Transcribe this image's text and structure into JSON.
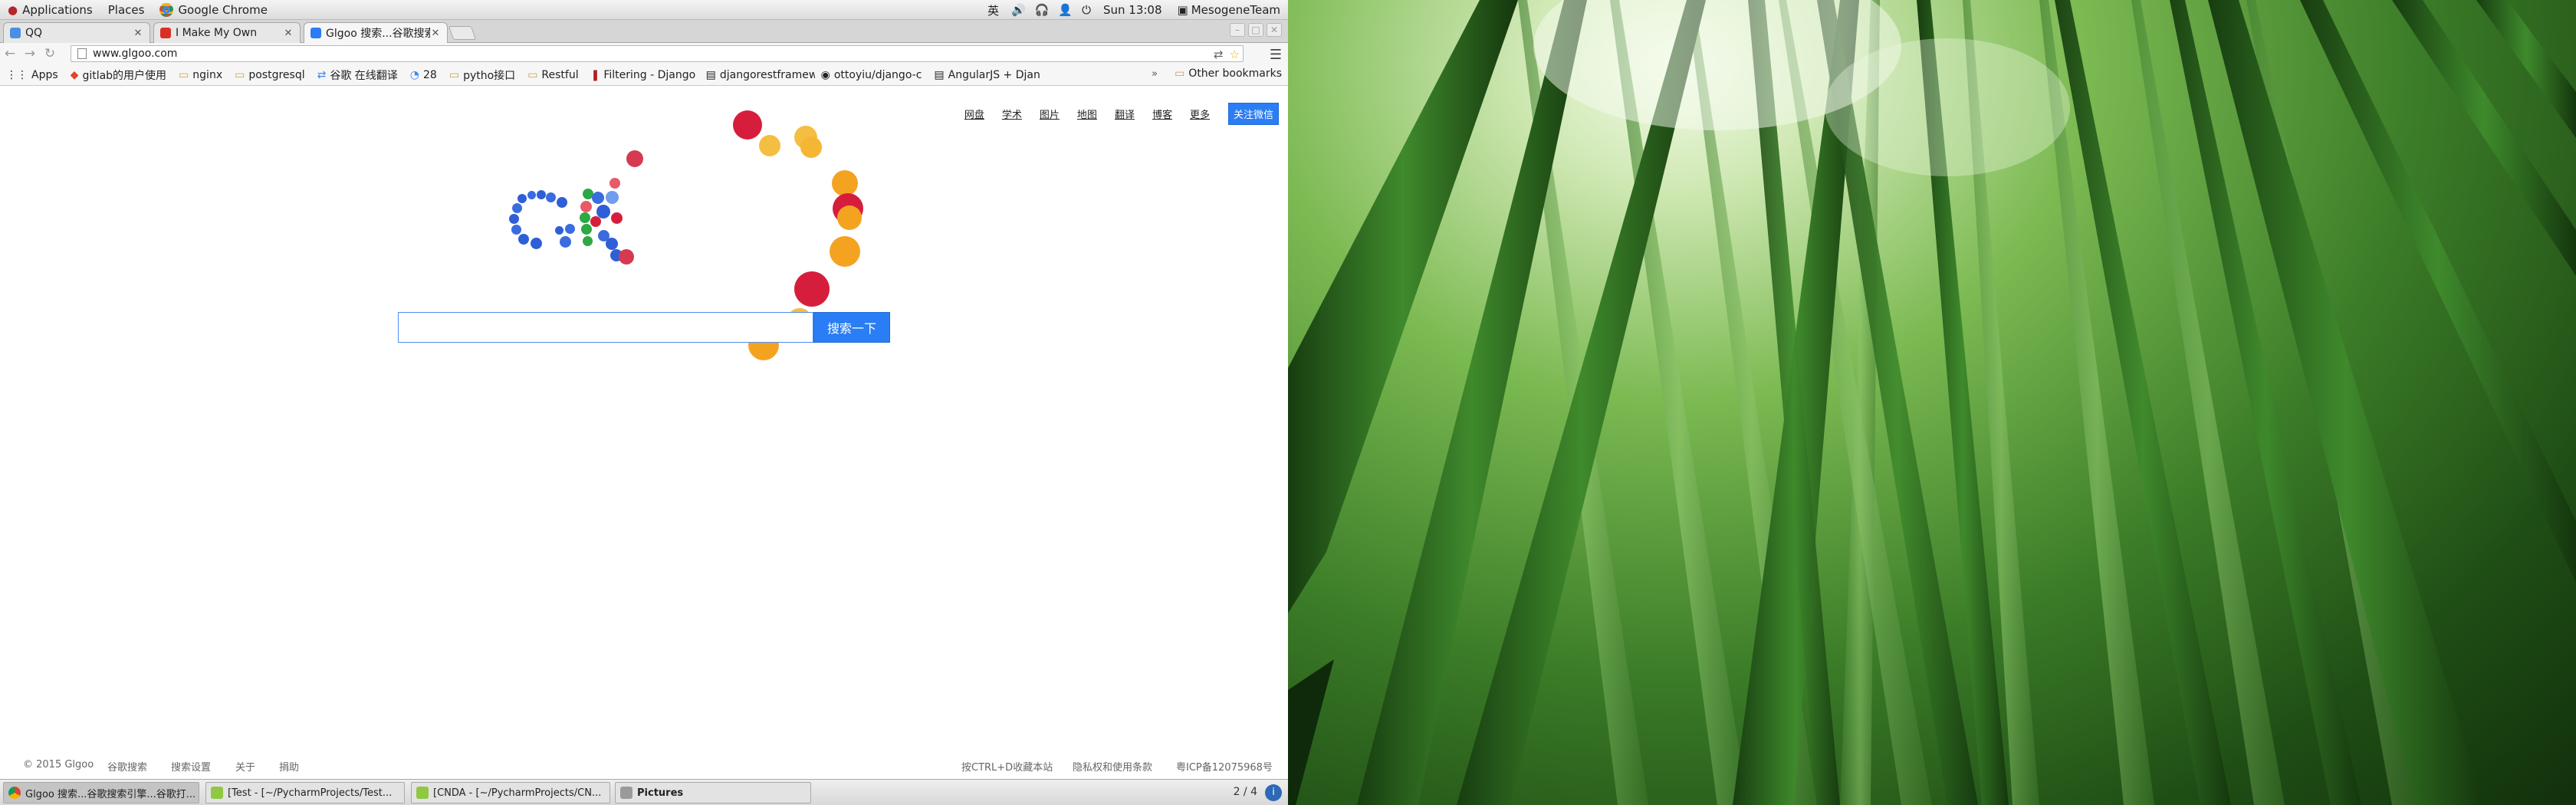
{
  "topbar": {
    "applications": "Applications",
    "places": "Places",
    "active_app": "Google Chrome",
    "input_method": "英",
    "clock": "Sun 13:08",
    "user": "MesogeneTeam"
  },
  "tabs": [
    {
      "title": "QQ",
      "color": "#4a90e2"
    },
    {
      "title": "I Make My Own",
      "color": "#d93025"
    },
    {
      "title": "Glgoo 搜索...谷歌搜索",
      "color": "#2a7df4"
    }
  ],
  "omnibox": {
    "url": "www.glgoo.com"
  },
  "bookmarks": {
    "items": [
      {
        "label": "Apps",
        "icon": "apps-grid-icon"
      },
      {
        "label": "gitlab的用户使用",
        "icon": "gitlab-icon"
      },
      {
        "label": "nginx",
        "icon": "folder-icon"
      },
      {
        "label": "postgresql",
        "icon": "folder-icon"
      },
      {
        "label": "谷歌 在线翻译",
        "icon": "translate-icon"
      },
      {
        "label": "28",
        "icon": "clock-icon"
      },
      {
        "label": "pytho接口",
        "icon": "folder-icon"
      },
      {
        "label": "Restful",
        "icon": "folder-icon"
      },
      {
        "label": "Filtering - Django",
        "icon": "bookmark-icon"
      },
      {
        "label": "djangorestframew",
        "icon": "doc-icon"
      },
      {
        "label": "ottoyiu/django-c",
        "icon": "github-icon"
      },
      {
        "label": "AngularJS + Djan",
        "icon": "doc-icon"
      }
    ],
    "more": "»",
    "other": "Other bookmarks"
  },
  "page": {
    "nav": [
      "网盘",
      "学术",
      "图片",
      "地图",
      "翻译",
      "博客",
      "更多"
    ],
    "wechat": "关注微信",
    "search_button": "搜索一下",
    "search_value": ""
  },
  "footer": {
    "copyright": "© 2015 Glgoo",
    "links_left": [
      "谷歌搜索",
      "搜索设置",
      "关于",
      "捐助"
    ],
    "bookmark_hint": "按CTRL+D收藏本站",
    "privacy": "隐私权和使用条款",
    "icp": "粤ICP备12075968号"
  },
  "taskbar": {
    "tasks": [
      {
        "label": "Glgoo 搜索...谷歌搜索引擎...谷歌打..."
      },
      {
        "label": "[Test - [~/PycharmProjects/Test..."
      },
      {
        "label": "[CNDA - [~/PycharmProjects/CN..."
      },
      {
        "label": "Pictures"
      }
    ],
    "workspace": "2 / 4"
  },
  "colors": {
    "accent": "#2a7df4",
    "logo_red": "#d61e3c",
    "logo_orange": "#f4a321",
    "logo_blue": "#2f5fd6",
    "logo_green": "#2ca844"
  }
}
